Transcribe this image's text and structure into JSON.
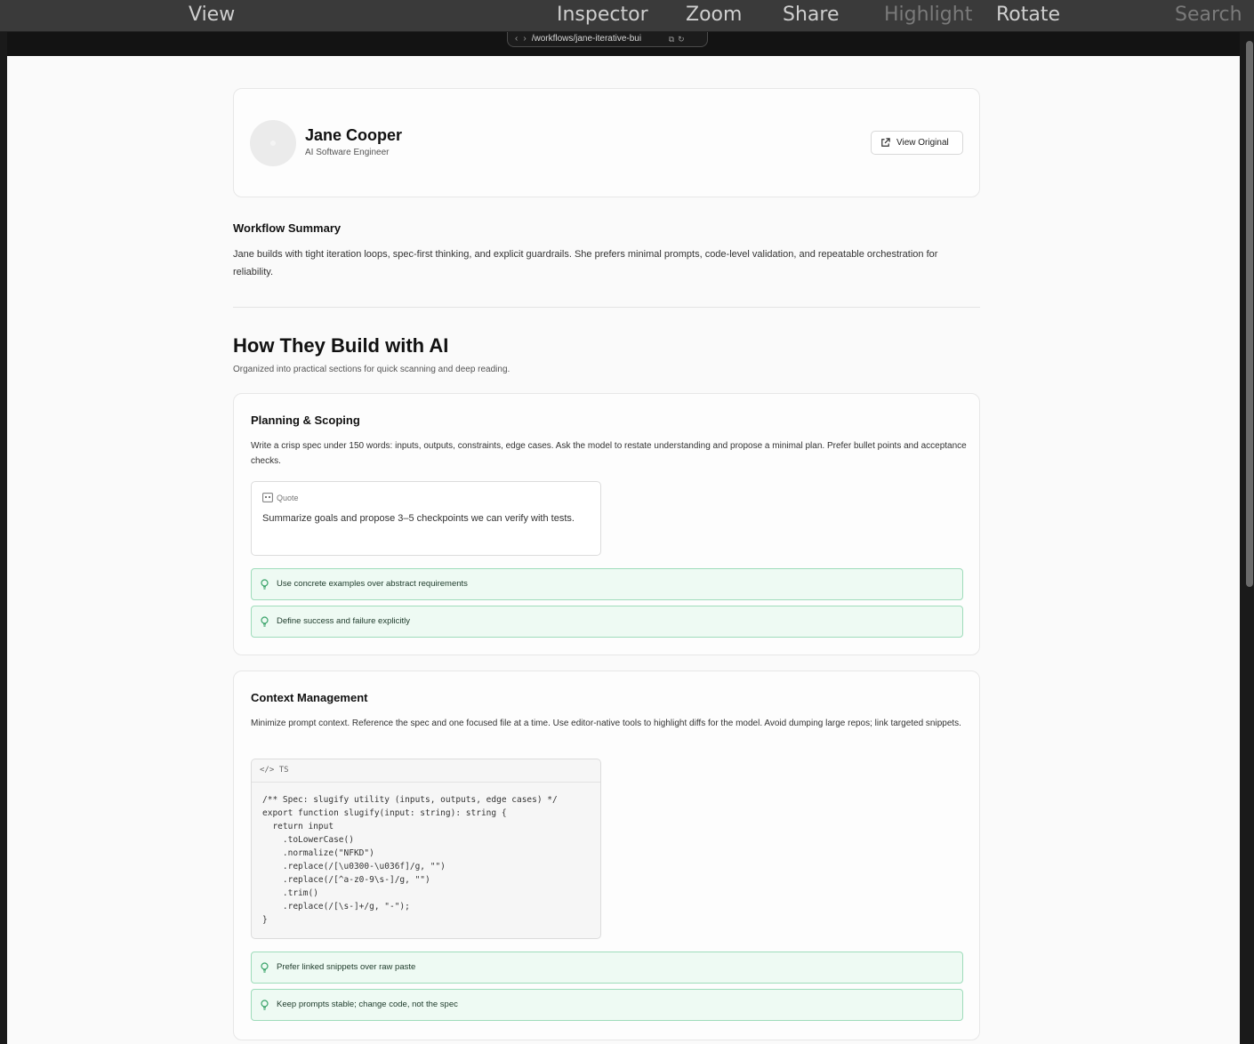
{
  "menu": {
    "items": [
      {
        "label": "View",
        "dim": false
      },
      {
        "label": "Inspector",
        "dim": false
      },
      {
        "label": "Zoom",
        "dim": false
      },
      {
        "label": "Share",
        "dim": false
      },
      {
        "label": "Highlight",
        "dim": true
      },
      {
        "label": "Rotate",
        "dim": false
      },
      {
        "label": "Search",
        "dim": true
      }
    ]
  },
  "browser": {
    "back_icon": "chevron-left-icon",
    "forward_icon": "chevron-right-icon",
    "url": "/workflows/jane-iterative-bui",
    "open_icon": "external-link-icon",
    "reload_icon": "reload-icon"
  },
  "profile": {
    "name": "Jane Cooper",
    "role": "AI Software Engineer",
    "view_original_label": "View Original"
  },
  "summary": {
    "heading": "Workflow Summary",
    "text": "Jane builds with tight iteration loops, spec-first thinking, and explicit guardrails. She prefers minimal prompts, code-level validation, and repeatable orchestration for reliability."
  },
  "main": {
    "heading": "How They Build with AI",
    "subheading": "Organized into practical sections for quick scanning and deep reading."
  },
  "sections": [
    {
      "title": "Planning & Scoping",
      "description": "Write a crisp spec under 150 words: inputs, outputs, constraints, edge cases. Ask the model to restate understanding and propose a minimal plan. Prefer bullet points and acceptance checks.",
      "quote_label": "Quote",
      "quote_text": "Summarize goals and propose 3–5 checkpoints we can verify with tests.",
      "tips": [
        "Use concrete examples over abstract requirements",
        "Define success and failure explicitly"
      ]
    },
    {
      "title": "Context Management",
      "description": "Minimize prompt context. Reference the spec and one focused file at a time. Use editor-native tools to highlight diffs for the model. Avoid dumping large repos; link targeted snippets.",
      "code_lang": "TS",
      "code": "/** Spec: slugify utility (inputs, outputs, edge cases) */\nexport function slugify(input: string): string {\n  return input\n    .toLowerCase()\n    .normalize(\"NFKD\")\n    .replace(/[\\u0300-\\u036f]/g, \"\")\n    .replace(/[^a-z0-9\\s-]/g, \"\")\n    .trim()\n    .replace(/[\\s-]+/g, \"-\");\n}",
      "tips": [
        "Prefer linked snippets over raw paste",
        "Keep prompts stable; change code, not the spec"
      ]
    }
  ],
  "colors": {
    "tip_border": "#9fdcbb",
    "tip_bg": "#eefaf3",
    "page_bg": "#fafafa",
    "chrome_bg": "#3a3a3a"
  }
}
